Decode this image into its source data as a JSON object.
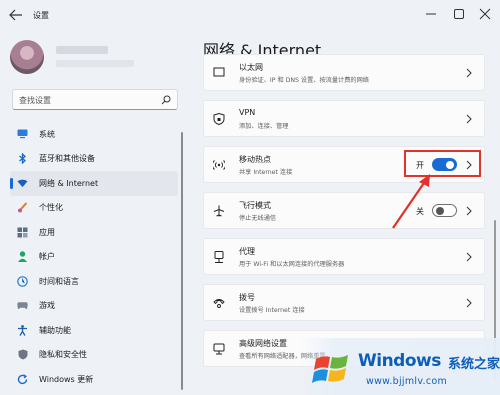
{
  "window": {
    "title": "设置"
  },
  "search": {
    "placeholder": "查找设置"
  },
  "sidebar": {
    "items": [
      {
        "label": "系统",
        "icon": "monitor-icon"
      },
      {
        "label": "蓝牙和其他设备",
        "icon": "bluetooth-icon"
      },
      {
        "label": "网络 & Internet",
        "icon": "wifi-icon",
        "active": true
      },
      {
        "label": "个性化",
        "icon": "brush-icon"
      },
      {
        "label": "应用",
        "icon": "apps-icon"
      },
      {
        "label": "帐户",
        "icon": "person-icon"
      },
      {
        "label": "时间和语言",
        "icon": "globe-clock-icon"
      },
      {
        "label": "游戏",
        "icon": "gamepad-icon"
      },
      {
        "label": "辅助功能",
        "icon": "accessibility-icon"
      },
      {
        "label": "隐私和安全性",
        "icon": "shield-icon"
      },
      {
        "label": "Windows 更新",
        "icon": "update-icon"
      }
    ]
  },
  "main": {
    "title": "网络 & Internet",
    "cards": [
      {
        "title": "以太网",
        "subtitle": "身份验证、IP 和 DNS 设置、按流量计费的网络"
      },
      {
        "title": "VPN",
        "subtitle": "添加、连接、管理"
      },
      {
        "title": "移动热点",
        "subtitle": "共享 Internet 连接",
        "toggle_label": "开",
        "toggle_on": true
      },
      {
        "title": "飞行模式",
        "subtitle": "停止无线通信",
        "toggle_label": "关",
        "toggle_on": false
      },
      {
        "title": "代理",
        "subtitle": "用于 Wi-Fi 和以太网连接的代理服务器"
      },
      {
        "title": "拨号",
        "subtitle": "设置拨号 Internet 连接"
      },
      {
        "title": "高级网络设置",
        "subtitle": "查看所有网络适配器，网络重置"
      }
    ]
  },
  "watermark": {
    "brand": "Windows",
    "brand_cn": "系统之家",
    "url": "www.bjjmlv.com"
  },
  "colors": {
    "accent": "#1a6ad5",
    "highlight": "#e0332b",
    "watermark": "#0e5eb8"
  }
}
